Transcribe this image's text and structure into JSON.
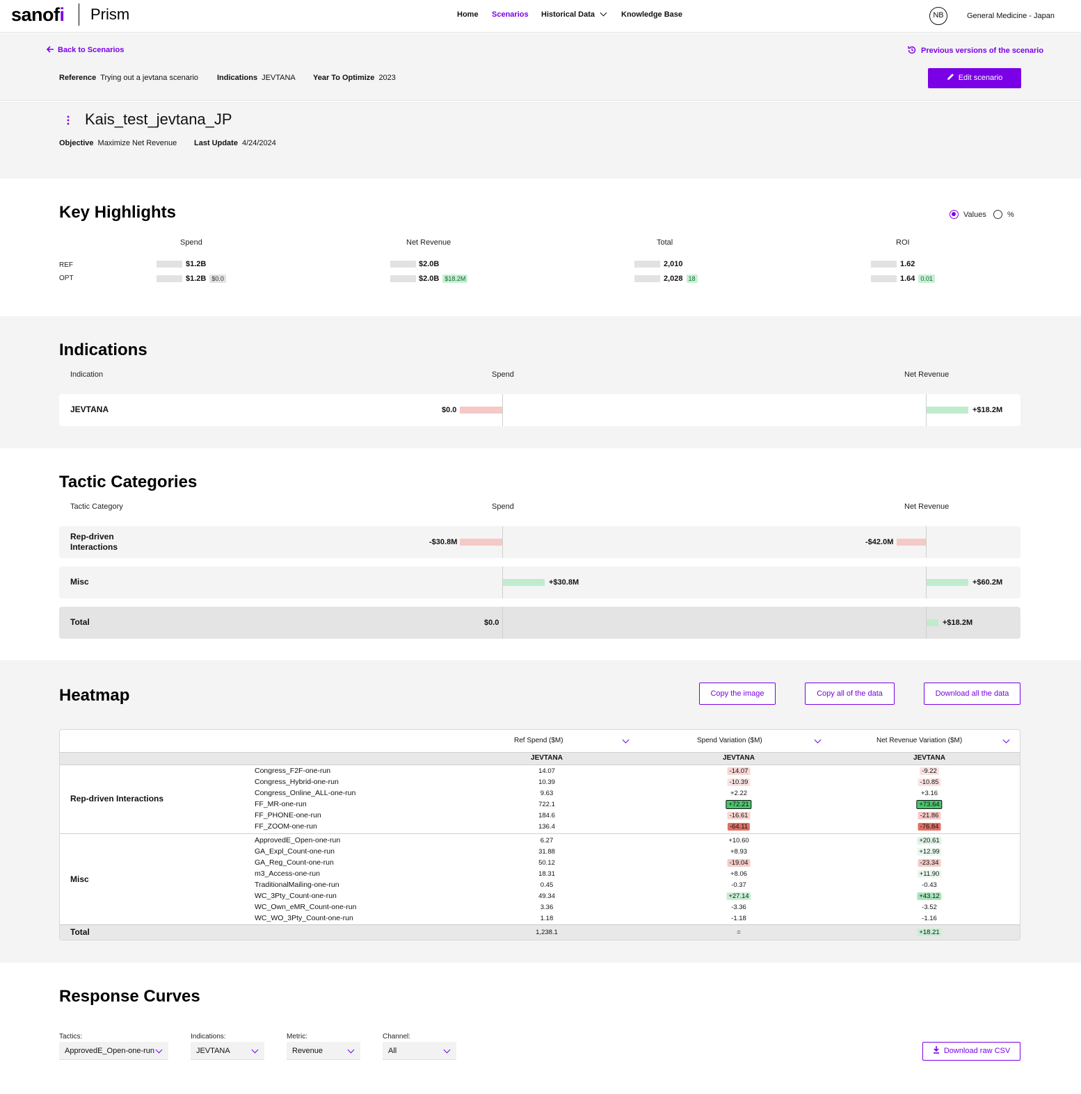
{
  "header": {
    "logo": "sanofi",
    "app_name": "Prism",
    "nav": [
      "Home",
      "Scenarios",
      "Historical Data",
      "Knowledge Base"
    ],
    "active_nav": "Scenarios",
    "avatar": "NB",
    "org": "General Medicine - Japan"
  },
  "scenario_bar": {
    "back_label": "Back to Scenarios",
    "prev_versions": "Previous versions of the scenario",
    "reference_label": "Reference",
    "reference_value": "Trying out a jevtana scenario",
    "indications_label": "Indications",
    "indications_value": "JEVTANA",
    "year_label": "Year To Optimize",
    "year_value": "2023",
    "edit_button": "Edit scenario"
  },
  "scenario": {
    "name": "Kais_test_jevtana_JP",
    "objective_label": "Objective",
    "objective_value": "Maximize Net Revenue",
    "last_update_label": "Last Update",
    "last_update_value": "4/24/2024"
  },
  "key_highlights": {
    "title": "Key Highlights",
    "toggle_values": "Values",
    "toggle_percent": "%",
    "row_labels": [
      "REF",
      "OPT"
    ],
    "metrics": [
      {
        "name": "Spend",
        "ref": "$1.2B",
        "opt": "$1.2B",
        "delta": "$0.0",
        "delta_type": "neutral"
      },
      {
        "name": "Net Revenue",
        "ref": "$2.0B",
        "opt": "$2.0B",
        "delta": "$18.2M",
        "delta_type": "positive"
      },
      {
        "name": "Total",
        "ref": "2,010",
        "opt": "2,028",
        "delta": "18",
        "delta_type": "positive"
      },
      {
        "name": "ROI",
        "ref": "1.62",
        "opt": "1.64",
        "delta": "0.01",
        "delta_type": "positive"
      }
    ]
  },
  "indications": {
    "title": "Indications",
    "col_name": "Indication",
    "col_spend": "Spend",
    "col_revenue": "Net Revenue",
    "rows": [
      {
        "name": "JEVTANA",
        "spend_label": "$0.0",
        "revenue_label": "+$18.2M"
      }
    ]
  },
  "tactic_categories": {
    "title": "Tactic Categories",
    "col_name": "Tactic Category",
    "col_spend": "Spend",
    "col_revenue": "Net Revenue",
    "rows": [
      {
        "name": "Rep-driven Interactions",
        "spend_label": "-$30.8M",
        "revenue_label": "-$42.0M"
      },
      {
        "name": "Misc",
        "spend_label": "+$30.8M",
        "revenue_label": "+$60.2M"
      },
      {
        "name": "Total",
        "spend_label": "$0.0",
        "revenue_label": "+$18.2M"
      }
    ]
  },
  "heatmap": {
    "title": "Heatmap",
    "copy_image": "Copy the image",
    "copy_data": "Copy all of the data",
    "download_data": "Download all the data",
    "col_ref": "Ref Spend ($M)",
    "col_spend_var": "Spend Variation ($M)",
    "col_rev_var": "Net Revenue Variation ($M)",
    "sub_header": "JEVTANA",
    "groups": [
      {
        "name": "Rep-driven Interactions",
        "rows": [
          {
            "tactic": "Congress_F2F-one-run",
            "ref": "14.07",
            "spend": "-14.07",
            "rev": "-9.22",
            "spend_c": "#f6d6d3",
            "rev_c": "#f9e3e1"
          },
          {
            "tactic": "Congress_Hybrid-one-run",
            "ref": "10.39",
            "spend": "-10.39",
            "rev": "-10.85",
            "spend_c": "#f9e3e1",
            "rev_c": "#f9e3e1"
          },
          {
            "tactic": "Congress_Online_ALL-one-run",
            "ref": "9.63",
            "spend": "+2.22",
            "rev": "+3.16",
            "spend_c": "",
            "rev_c": ""
          },
          {
            "tactic": "FF_MR-one-run",
            "ref": "722.1",
            "spend": "+72.21",
            "rev": "+73.64",
            "spend_c": "#4cc46e",
            "rev_c": "#4cc46e"
          },
          {
            "tactic": "FF_PHONE-one-run",
            "ref": "184.6",
            "spend": "-16.61",
            "rev": "-21.86",
            "spend_c": "#f6d6d3",
            "rev_c": "#f4cbc7"
          },
          {
            "tactic": "FF_ZOOM-one-run",
            "ref": "136.4",
            "spend": "-64.11",
            "rev": "-76.84",
            "spend_c": "#e26f63",
            "rev_c": "#e26f63"
          }
        ]
      },
      {
        "name": "Misc",
        "rows": [
          {
            "tactic": "ApprovedE_Open-one-run",
            "ref": "6.27",
            "spend": "+10.60",
            "rev": "+20.61",
            "spend_c": "",
            "rev_c": "#dff4e6"
          },
          {
            "tactic": "GA_Expl_Count-one-run",
            "ref": "31.88",
            "spend": "+8.93",
            "rev": "+12.99",
            "spend_c": "",
            "rev_c": "#eaf7ee"
          },
          {
            "tactic": "GA_Reg_Count-one-run",
            "ref": "50.12",
            "spend": "-19.04",
            "rev": "-23.34",
            "spend_c": "#f4cbc7",
            "rev_c": "#f4cbc7"
          },
          {
            "tactic": "m3_Access-one-run",
            "ref": "18.31",
            "spend": "+8.06",
            "rev": "+11.90",
            "spend_c": "",
            "rev_c": "#eaf7ee"
          },
          {
            "tactic": "TraditionalMailing-one-run",
            "ref": "0.45",
            "spend": "-0.37",
            "rev": "-0.43",
            "spend_c": "",
            "rev_c": ""
          },
          {
            "tactic": "WC_3Pty_Count-one-run",
            "ref": "49.34",
            "spend": "+27.14",
            "rev": "+43.12",
            "spend_c": "#c8efd5",
            "rev_c": "#a9e5bc"
          },
          {
            "tactic": "WC_Own_eMR_Count-one-run",
            "ref": "3.36",
            "spend": "-3.36",
            "rev": "-3.52",
            "spend_c": "",
            "rev_c": ""
          },
          {
            "tactic": "WC_WO_3Pty_Count-one-run",
            "ref": "1.18",
            "spend": "-1.18",
            "rev": "-1.16",
            "spend_c": "",
            "rev_c": ""
          }
        ]
      }
    ],
    "total": {
      "name": "Total",
      "ref": "1,238.1",
      "spend": "=",
      "rev": "+18.21",
      "rev_c": "#c8efd5"
    }
  },
  "response_curves": {
    "title": "Response Curves",
    "filters": [
      {
        "label": "Tactics:",
        "value": "ApprovedE_Open-one-run"
      },
      {
        "label": "Indications:",
        "value": "JEVTANA"
      },
      {
        "label": "Metric:",
        "value": "Revenue"
      },
      {
        "label": "Channel:",
        "value": "All"
      }
    ],
    "download_csv": "Download raw CSV"
  }
}
